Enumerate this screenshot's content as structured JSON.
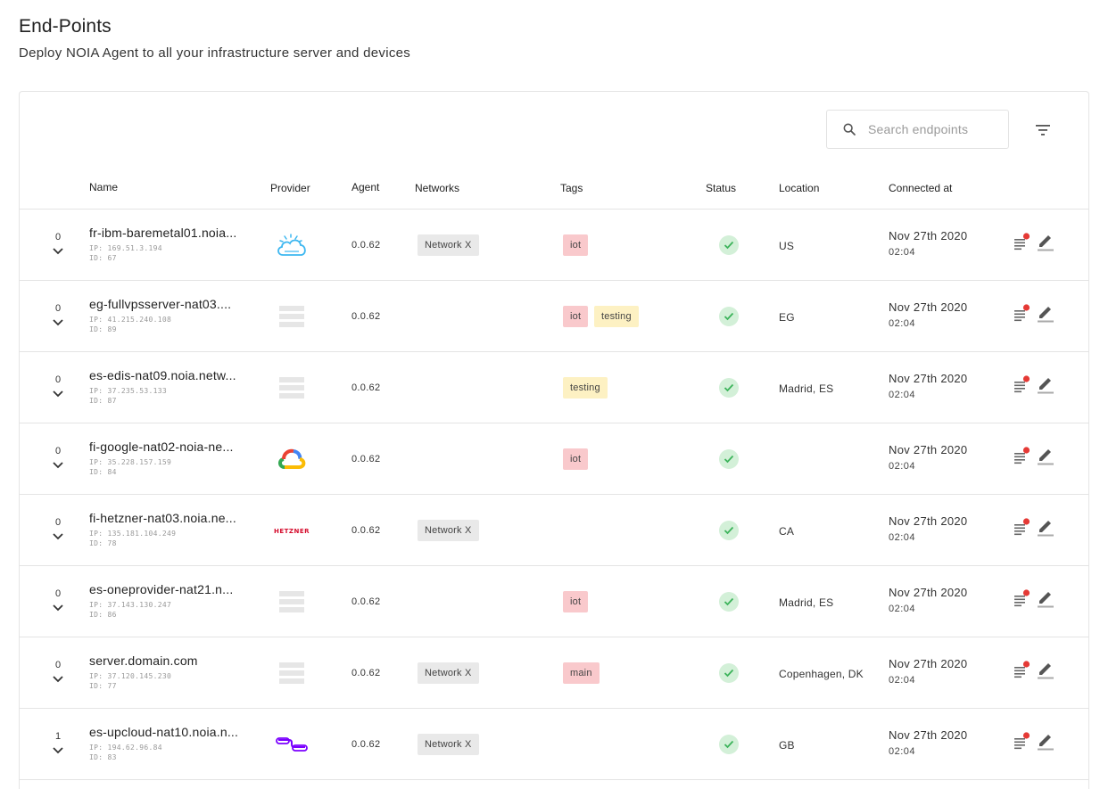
{
  "page": {
    "title": "End-Points",
    "subtitle": "Deploy NOIA Agent to all your infrastructure server and devices"
  },
  "search": {
    "placeholder": "Search endpoints"
  },
  "table": {
    "columns": {
      "name": "Name",
      "provider": "Provider",
      "agent": "Agent",
      "networks": "Networks",
      "tags": "Tags",
      "status": "Status",
      "location": "Location",
      "connected_at": "Connected at"
    },
    "rows": [
      {
        "count": "0",
        "name": "fr-ibm-baremetal01.noia...",
        "ip": "IP: 169.51.3.194",
        "id": "ID: 67",
        "provider": "ibm-cloud-icon",
        "agent": "0.0.62",
        "network": "Network X",
        "tags": [
          {
            "label": "iot",
            "color": "red"
          }
        ],
        "status": "connected",
        "location": "US",
        "date": "Nov 27th 2020",
        "time": "02:04"
      },
      {
        "count": "0",
        "name": "eg-fullvpsserver-nat03....",
        "ip": "IP: 41.215.240.108",
        "id": "ID: 89",
        "provider": "generic-server-icon",
        "agent": "0.0.62",
        "network": "",
        "tags": [
          {
            "label": "iot",
            "color": "red"
          },
          {
            "label": "testing",
            "color": "yellow"
          }
        ],
        "status": "connected",
        "location": "EG",
        "date": "Nov 27th 2020",
        "time": "02:04"
      },
      {
        "count": "0",
        "name": "es-edis-nat09.noia.netw...",
        "ip": "IP: 37.235.53.133",
        "id": "ID: 87",
        "provider": "generic-server-icon",
        "agent": "0.0.62",
        "network": "",
        "tags": [
          {
            "label": "testing",
            "color": "yellow"
          }
        ],
        "status": "connected",
        "location": "Madrid, ES",
        "date": "Nov 27th 2020",
        "time": "02:04"
      },
      {
        "count": "0",
        "name": "fi-google-nat02-noia-ne...",
        "ip": "IP: 35.228.157.159",
        "id": "ID: 84",
        "provider": "google-cloud-icon",
        "agent": "0.0.62",
        "network": "",
        "tags": [
          {
            "label": "iot",
            "color": "red"
          }
        ],
        "status": "connected",
        "location": "",
        "date": "Nov 27th 2020",
        "time": "02:04"
      },
      {
        "count": "0",
        "name": "fi-hetzner-nat03.noia.ne...",
        "ip": "IP: 135.181.104.249",
        "id": "ID: 78",
        "provider": "hetzner-logo",
        "provider_text": "HETZNER",
        "agent": "0.0.62",
        "network": "Network X",
        "tags": [],
        "status": "connected",
        "location": "CA",
        "date": "Nov 27th 2020",
        "time": "02:04"
      },
      {
        "count": "0",
        "name": "es-oneprovider-nat21.n...",
        "ip": "IP: 37.143.130.247",
        "id": "ID: 86",
        "provider": "generic-server-icon",
        "agent": "0.0.62",
        "network": "",
        "tags": [
          {
            "label": "iot",
            "color": "red"
          }
        ],
        "status": "connected",
        "location": "Madrid, ES",
        "date": "Nov 27th 2020",
        "time": "02:04"
      },
      {
        "count": "0",
        "name": "server.domain.com",
        "ip": "IP: 37.120.145.230",
        "id": "ID: 77",
        "provider": "generic-server-icon",
        "agent": "0.0.62",
        "network": "Network X",
        "tags": [
          {
            "label": "main",
            "color": "red"
          }
        ],
        "status": "connected",
        "location": "Copenhagen, DK",
        "date": "Nov 27th 2020",
        "time": "02:04"
      },
      {
        "count": "1",
        "name": "es-upcloud-nat10.noia.n...",
        "ip": "IP: 194.62.96.84",
        "id": "ID: 83",
        "provider": "upcloud-icon",
        "agent": "0.0.62",
        "network": "Network X",
        "tags": [],
        "status": "connected",
        "location": "GB",
        "date": "Nov 27th 2020",
        "time": "02:04"
      }
    ]
  },
  "colors": {
    "tag_red": "#f9c9cc",
    "tag_yellow": "#fdf1c3",
    "network_chip": "#e9e9e9",
    "status_ok_bg": "#d3f0d8",
    "status_ok_check": "#3cb35a",
    "notification_dot": "#e53935"
  }
}
